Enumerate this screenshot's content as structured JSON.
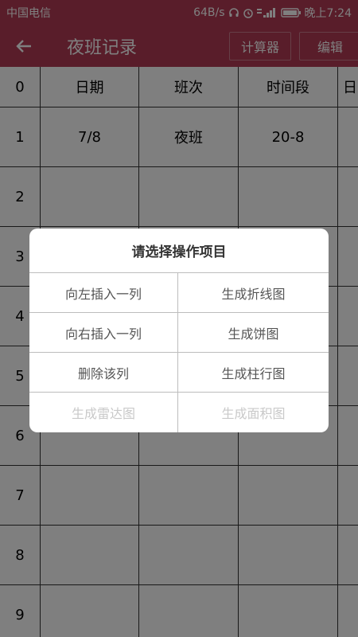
{
  "status": {
    "carrier": "中国电信",
    "speed": "64B/s",
    "time": "晚上7:24"
  },
  "appbar": {
    "title": "夜班记录",
    "calc_label": "计算器",
    "edit_label": "编辑"
  },
  "table": {
    "header": [
      "0",
      "日期",
      "班次",
      "时间段",
      "日"
    ],
    "rows": [
      [
        "1",
        "7/8",
        "夜班",
        "20-8",
        ""
      ],
      [
        "2",
        "",
        "",
        "",
        ""
      ],
      [
        "3",
        "",
        "",
        "",
        ""
      ],
      [
        "4",
        "",
        "",
        "",
        ""
      ],
      [
        "5",
        "",
        "",
        "",
        ""
      ],
      [
        "6",
        "",
        "",
        "",
        ""
      ],
      [
        "7",
        "",
        "",
        "",
        ""
      ],
      [
        "8",
        "",
        "",
        "",
        ""
      ],
      [
        "9",
        "",
        "",
        "",
        ""
      ]
    ]
  },
  "dialog": {
    "title": "请选择操作项目",
    "options": [
      {
        "label": "向左插入一列",
        "enabled": true
      },
      {
        "label": "生成折线图",
        "enabled": true
      },
      {
        "label": "向右插入一列",
        "enabled": true
      },
      {
        "label": "生成饼图",
        "enabled": true
      },
      {
        "label": "删除该列",
        "enabled": true
      },
      {
        "label": "生成柱行图",
        "enabled": true
      },
      {
        "label": "生成雷达图",
        "enabled": false
      },
      {
        "label": "生成面积图",
        "enabled": false
      }
    ]
  },
  "colors": {
    "primary": "#b23a54",
    "overlay": "rgba(0,0,0,0.5)"
  }
}
